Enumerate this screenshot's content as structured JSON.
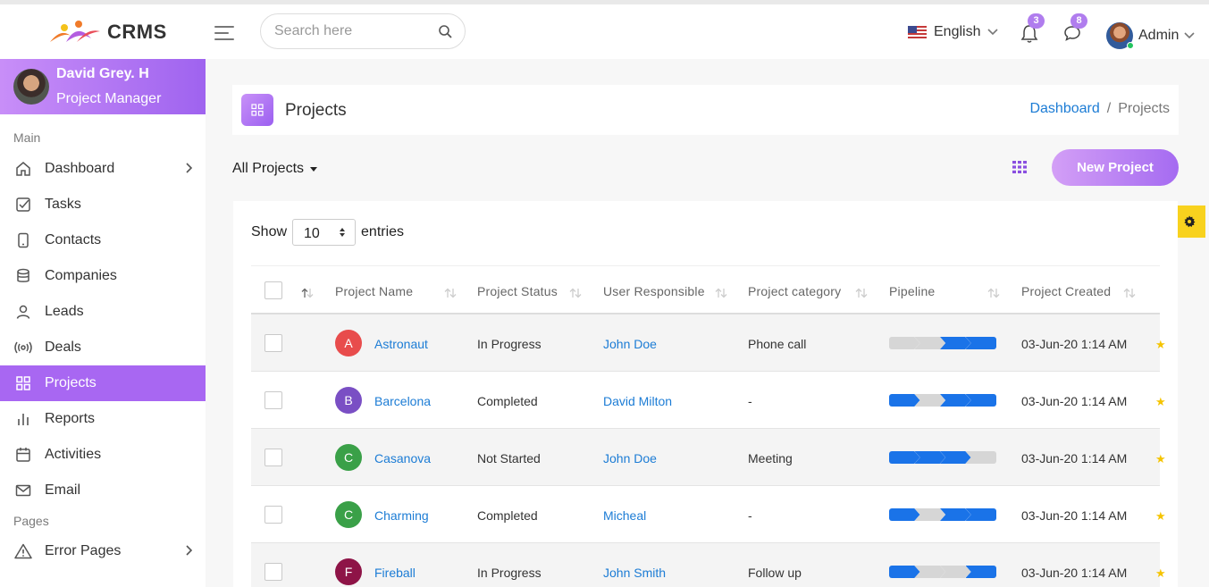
{
  "app": {
    "name": "CRMS"
  },
  "search": {
    "placeholder": "Search here"
  },
  "header": {
    "language": "English",
    "notifications_count": "3",
    "messages_count": "8",
    "user": "Admin"
  },
  "profile": {
    "name": "David Grey. H",
    "role": "Project Manager"
  },
  "sidebar": {
    "section_main": "Main",
    "section_pages": "Pages",
    "items": [
      {
        "label": "Dashboard",
        "icon": "home-icon",
        "has_submenu": true
      },
      {
        "label": "Tasks",
        "icon": "checkbox-icon"
      },
      {
        "label": "Contacts",
        "icon": "phone-icon"
      },
      {
        "label": "Companies",
        "icon": "database-icon"
      },
      {
        "label": "Leads",
        "icon": "user-icon"
      },
      {
        "label": "Deals",
        "icon": "broadcast-icon"
      },
      {
        "label": "Projects",
        "icon": "grid-icon",
        "active": true
      },
      {
        "label": "Reports",
        "icon": "bar-chart-icon"
      },
      {
        "label": "Activities",
        "icon": "calendar-icon"
      },
      {
        "label": "Email",
        "icon": "mail-icon"
      }
    ],
    "pages_items": [
      {
        "label": "Error Pages",
        "icon": "warning-icon",
        "has_submenu": true
      }
    ]
  },
  "page": {
    "title": "Projects",
    "breadcrumb_home": "Dashboard",
    "breadcrumb_sep": "/",
    "breadcrumb_current": "Projects",
    "filter_label": "All Projects",
    "new_button": "New Project"
  },
  "table": {
    "show_label": "Show",
    "entries_value": "10",
    "entries_label": "entries",
    "columns": [
      "Project Name",
      "Project Status",
      "User Responsible",
      "Project category",
      "Pipeline",
      "Project Created"
    ],
    "rows": [
      {
        "initial": "A",
        "avatar_color": "#e84c4c",
        "name": "Astronaut",
        "status": "In Progress",
        "user": "John Doe",
        "category": "Phone call",
        "pipeline": [
          0,
          0,
          1,
          1
        ],
        "created": "03-Jun-20 1:14 AM"
      },
      {
        "initial": "B",
        "avatar_color": "#7a4fc4",
        "name": "Barcelona",
        "status": "Completed",
        "user": "David Milton",
        "category": "-",
        "pipeline": [
          1,
          0,
          1,
          1
        ],
        "created": "03-Jun-20 1:14 AM"
      },
      {
        "initial": "C",
        "avatar_color": "#3aa048",
        "name": "Casanova",
        "status": "Not Started",
        "user": "John Doe",
        "category": "Meeting",
        "pipeline": [
          1,
          1,
          1,
          0
        ],
        "created": "03-Jun-20 1:14 AM"
      },
      {
        "initial": "C",
        "avatar_color": "#3aa048",
        "name": "Charming",
        "status": "Completed",
        "user": "Micheal",
        "category": "-",
        "pipeline": [
          1,
          0,
          1,
          1
        ],
        "created": "03-Jun-20 1:14 AM"
      },
      {
        "initial": "F",
        "avatar_color": "#8e1447",
        "name": "Fireball",
        "status": "In Progress",
        "user": "John Smith",
        "category": "Follow up",
        "pipeline": [
          1,
          0,
          0,
          1
        ],
        "created": "03-Jun-20 1:14 AM"
      }
    ]
  },
  "colors": {
    "accent": "#a867f2",
    "link": "#1c7cd5",
    "pipeline_on": "#1a73e8",
    "pipeline_off": "#d6d6d6",
    "settings_tab": "#f8d21e"
  }
}
